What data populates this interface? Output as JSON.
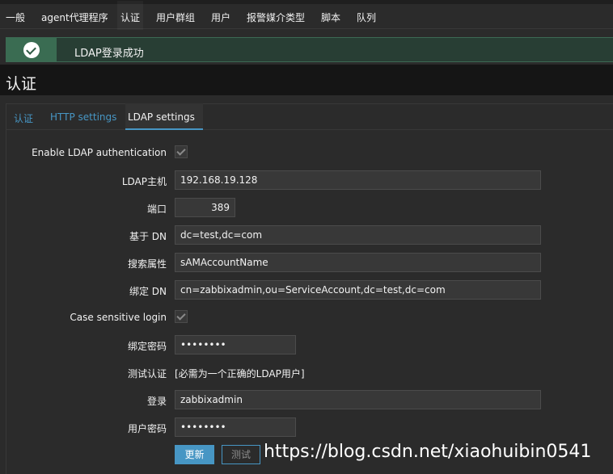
{
  "nav": {
    "items": [
      {
        "label": "一般"
      },
      {
        "label": "agent代理程序"
      },
      {
        "label": "认证",
        "active": true
      },
      {
        "label": "用户群组"
      },
      {
        "label": "用户"
      },
      {
        "label": "报警媒介类型"
      },
      {
        "label": "脚本"
      },
      {
        "label": "队列"
      }
    ]
  },
  "message": {
    "text": "LDAP登录成功",
    "type": "success",
    "color": "#3a6c52"
  },
  "page": {
    "title": "认证"
  },
  "tabs": [
    {
      "label": "认证"
    },
    {
      "label": "HTTP settings"
    },
    {
      "label": "LDAP settings",
      "active": true
    }
  ],
  "form": {
    "enable_ldap": {
      "label": "Enable LDAP authentication",
      "checked": true
    },
    "host": {
      "label": "LDAP主机",
      "value": "192.168.19.128"
    },
    "port": {
      "label": "端口",
      "value": "389"
    },
    "base_dn": {
      "label": "基于 DN",
      "value": "dc=test,dc=com"
    },
    "search_attr": {
      "label": "搜索属性",
      "value": "sAMAccountName"
    },
    "bind_dn": {
      "label": "绑定 DN",
      "value": "cn=zabbixadmin,ou=ServiceAccount,dc=test,dc=com"
    },
    "case_sensitive": {
      "label": "Case sensitive login",
      "checked": true
    },
    "bind_password": {
      "label": "绑定密码",
      "value": "••••••••"
    },
    "test_auth": {
      "label": "测试认证",
      "value": "[必需为一个正确的LDAP用户]"
    },
    "login": {
      "label": "登录",
      "value": "zabbixadmin"
    },
    "user_password": {
      "label": "用户密码",
      "value": "••••••••"
    }
  },
  "buttons": {
    "update": "更新",
    "test": "测试"
  },
  "watermark": "https://blog.csdn.net/xiaohuibin0541",
  "colors": {
    "accent": "#4796c4",
    "background": "#2b2b2b",
    "success": "#3a6c52"
  }
}
